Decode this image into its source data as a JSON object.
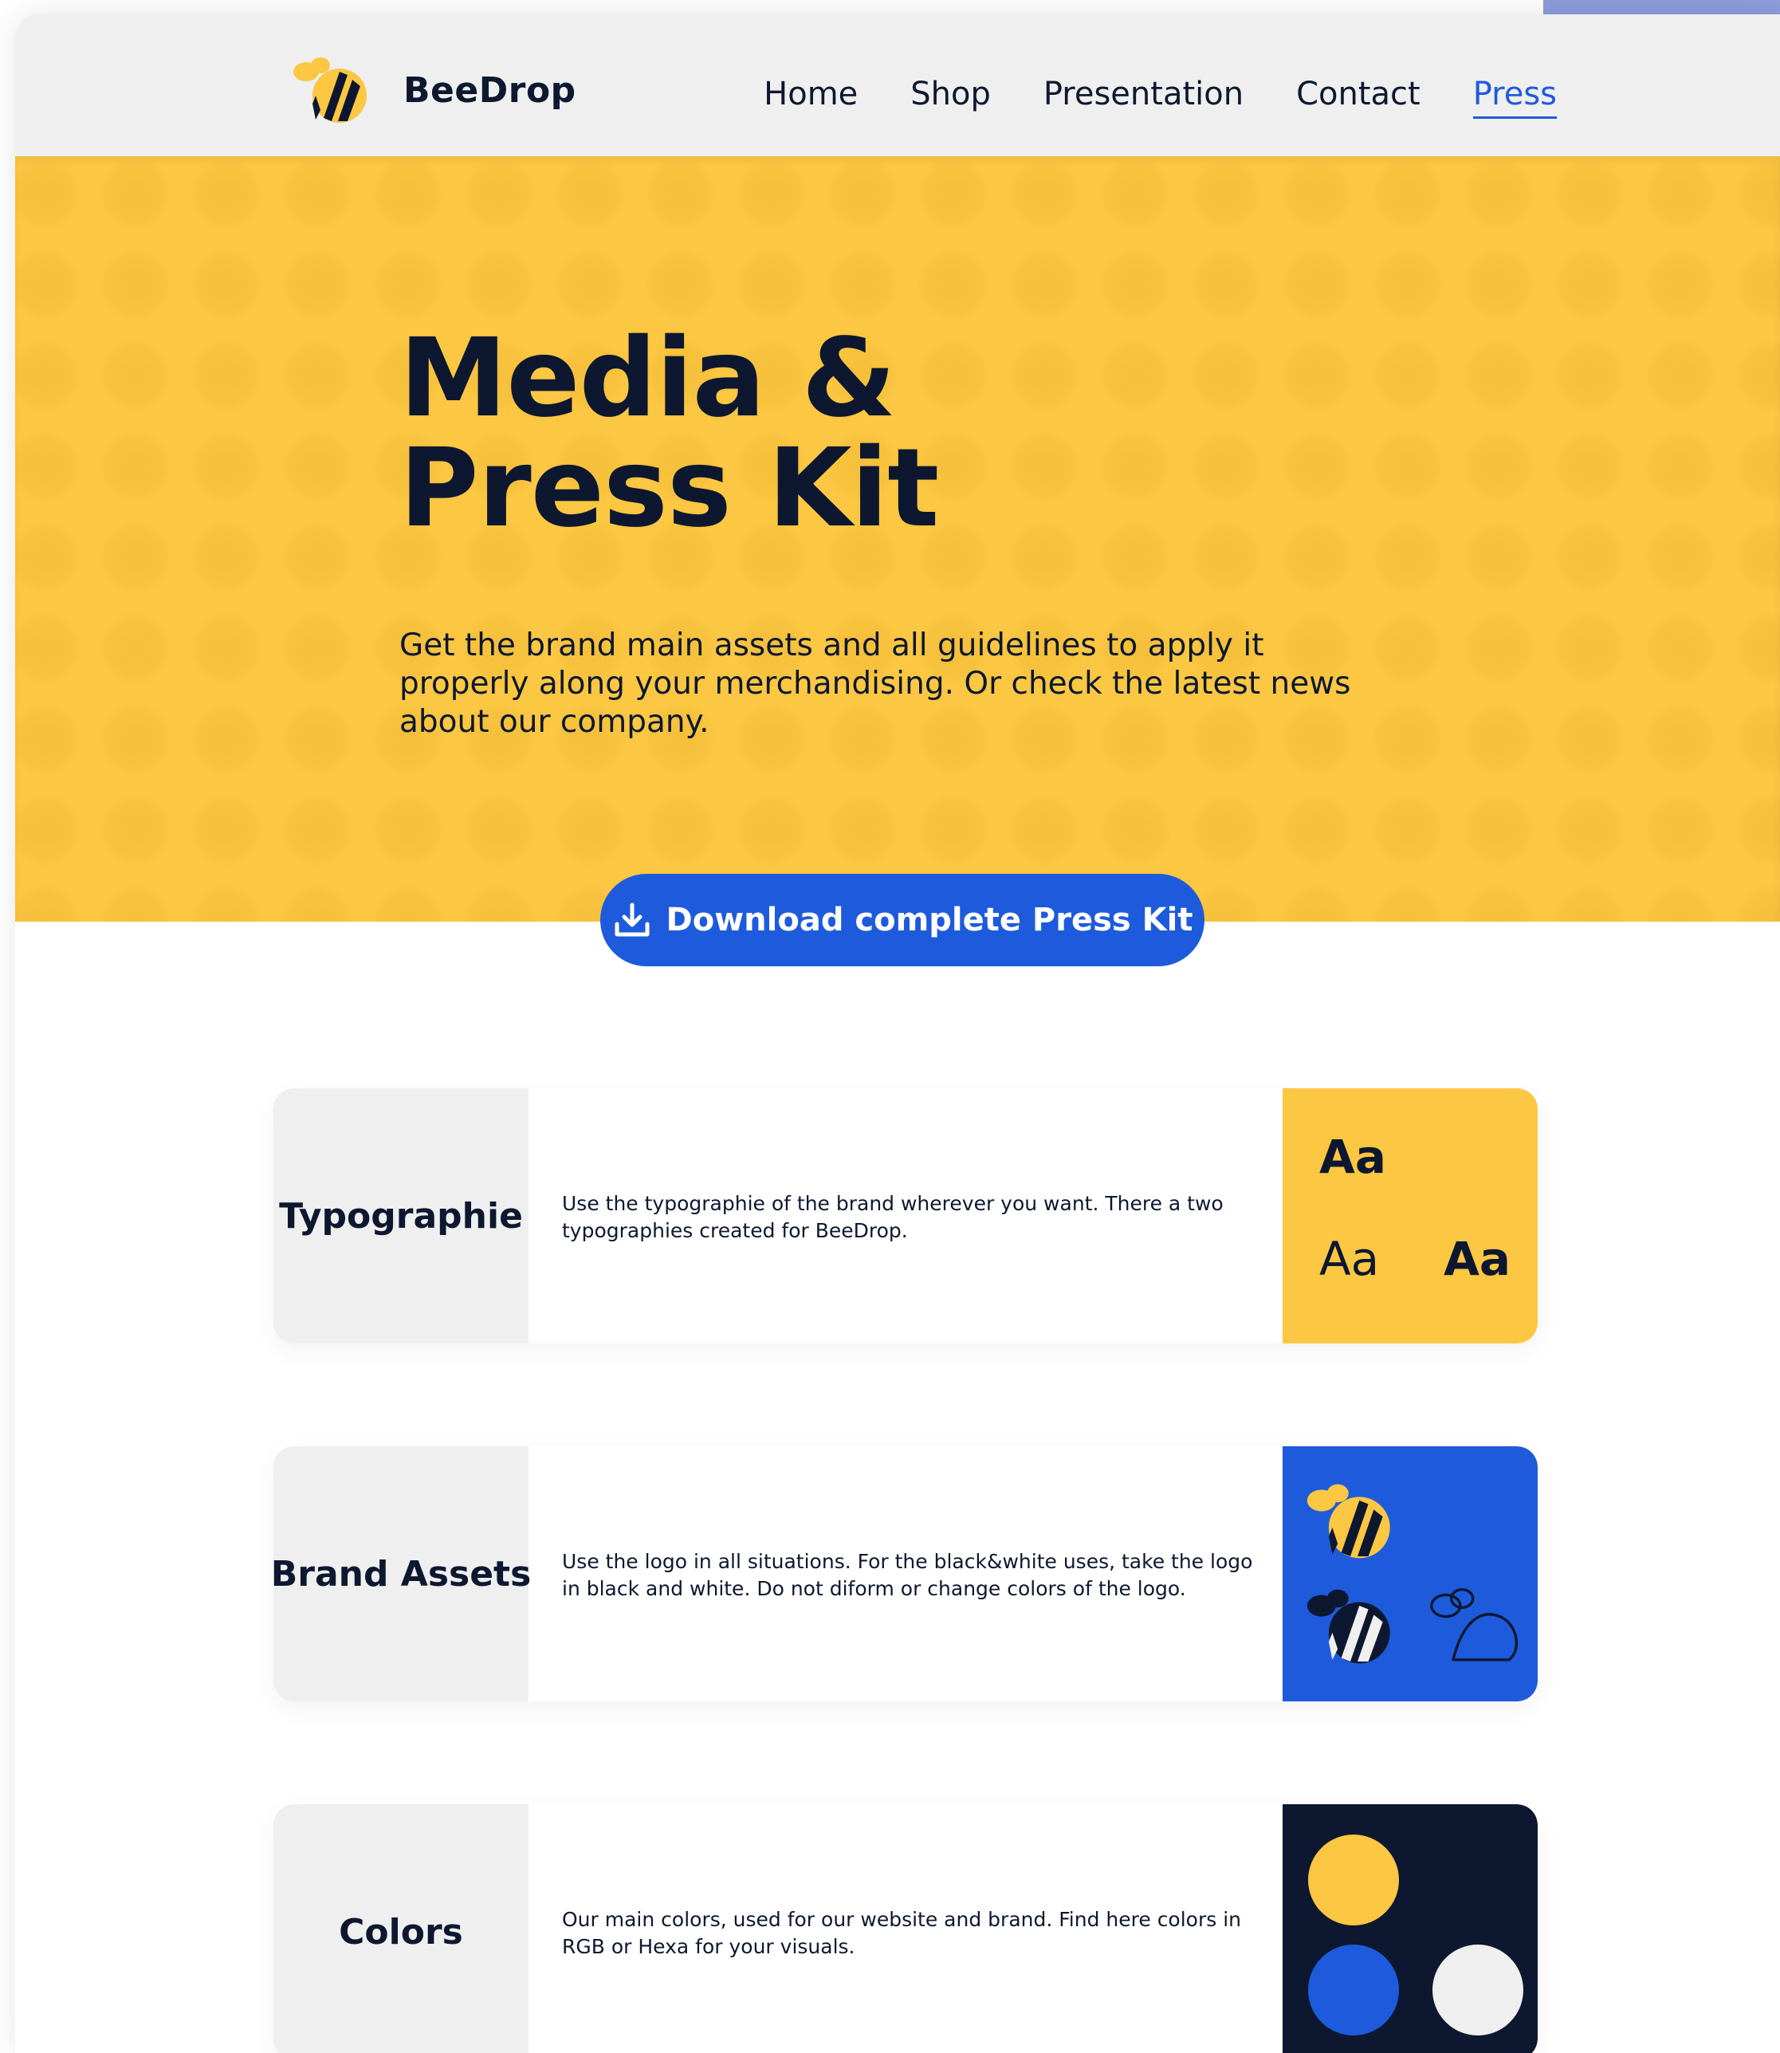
{
  "brand": {
    "name": "BeeDrop",
    "colors": {
      "yellow": "#fcc742",
      "blue": "#1e5bdc",
      "navy": "#0d1830",
      "light_gray": "#efefef"
    }
  },
  "nav": {
    "items": [
      {
        "label": "Home",
        "active": false
      },
      {
        "label": "Shop",
        "active": false
      },
      {
        "label": "Presentation",
        "active": false
      },
      {
        "label": "Contact",
        "active": false
      },
      {
        "label": "Press",
        "active": true
      }
    ]
  },
  "hero": {
    "title": "Media &\nPress Kit",
    "description": "Get the brand main assets and all guidelines to apply it properly along your merchandising. Or check the latest news about our company.",
    "download_label": "Download complete Press Kit",
    "download_icon": "download-icon"
  },
  "sections": [
    {
      "title": "Typographie",
      "text": "Use the typographie of the brand wherever you want. There a two typographies created for BeeDrop.",
      "samples": [
        "Aa",
        "Aa",
        "Aa"
      ]
    },
    {
      "title": "Brand Assets",
      "text": "Use the logo in all situations. For the black&white uses, take the logo in black and white. Do not diform or change colors of the logo.",
      "icons": [
        "bee-color-icon",
        "bee-inverted-icon",
        "bee-outline-icon"
      ]
    },
    {
      "title": "Colors",
      "text": "Our main colors, used for our website and brand. Find here colors in RGB or Hexa for your visuals.",
      "swatches": [
        "#fcc742",
        "#1e5bdc",
        "#efefef"
      ]
    }
  ]
}
